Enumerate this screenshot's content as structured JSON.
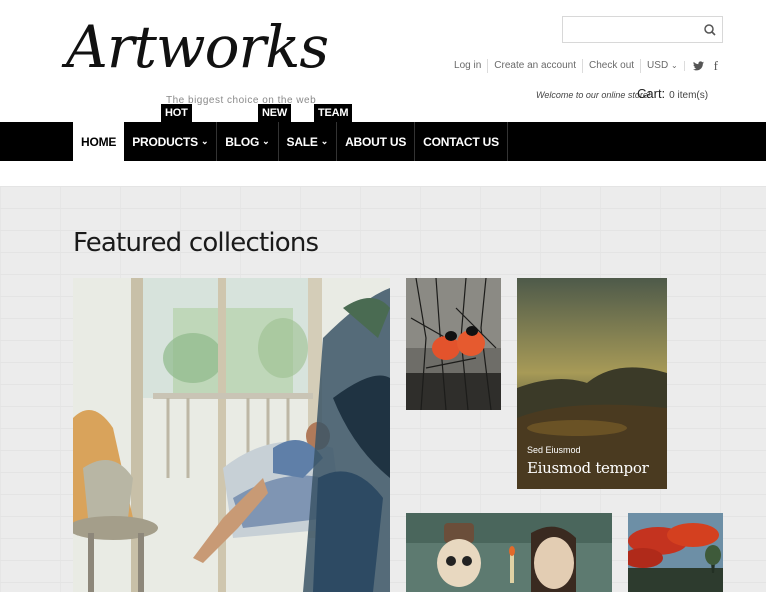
{
  "brand": {
    "logo_text": "Artworks",
    "tagline": "The biggest choice on the web"
  },
  "search": {
    "placeholder": "",
    "icon": "search-icon"
  },
  "top_links": {
    "login": "Log in",
    "create_account": "Create an account",
    "checkout": "Check out",
    "currency": "USD",
    "twitter": "twitter-icon",
    "facebook": "f"
  },
  "welcome": "Welcome to our online store!",
  "cart": {
    "label": "Cart:",
    "items": "0 item(s)"
  },
  "nav": {
    "items": [
      {
        "label": "HOME",
        "active": true,
        "dropdown": false
      },
      {
        "label": "PRODUCTS",
        "active": false,
        "dropdown": true
      },
      {
        "label": "BLOG",
        "active": false,
        "dropdown": true
      },
      {
        "label": "SALE",
        "active": false,
        "dropdown": true
      },
      {
        "label": "ABOUT US",
        "active": false,
        "dropdown": false
      },
      {
        "label": "CONTACT US",
        "active": false,
        "dropdown": false
      }
    ],
    "badges": {
      "products": "HOT",
      "sale": "NEW",
      "about": "TEAM"
    }
  },
  "featured": {
    "title": "Featured collections",
    "tile_caption": {
      "sub": "Sed Eiusmod",
      "title": "Eiusmod tempor"
    }
  },
  "colors": {
    "nav_bg": "#000000",
    "nav_text": "#ffffff",
    "page_bg": "#ececec"
  }
}
